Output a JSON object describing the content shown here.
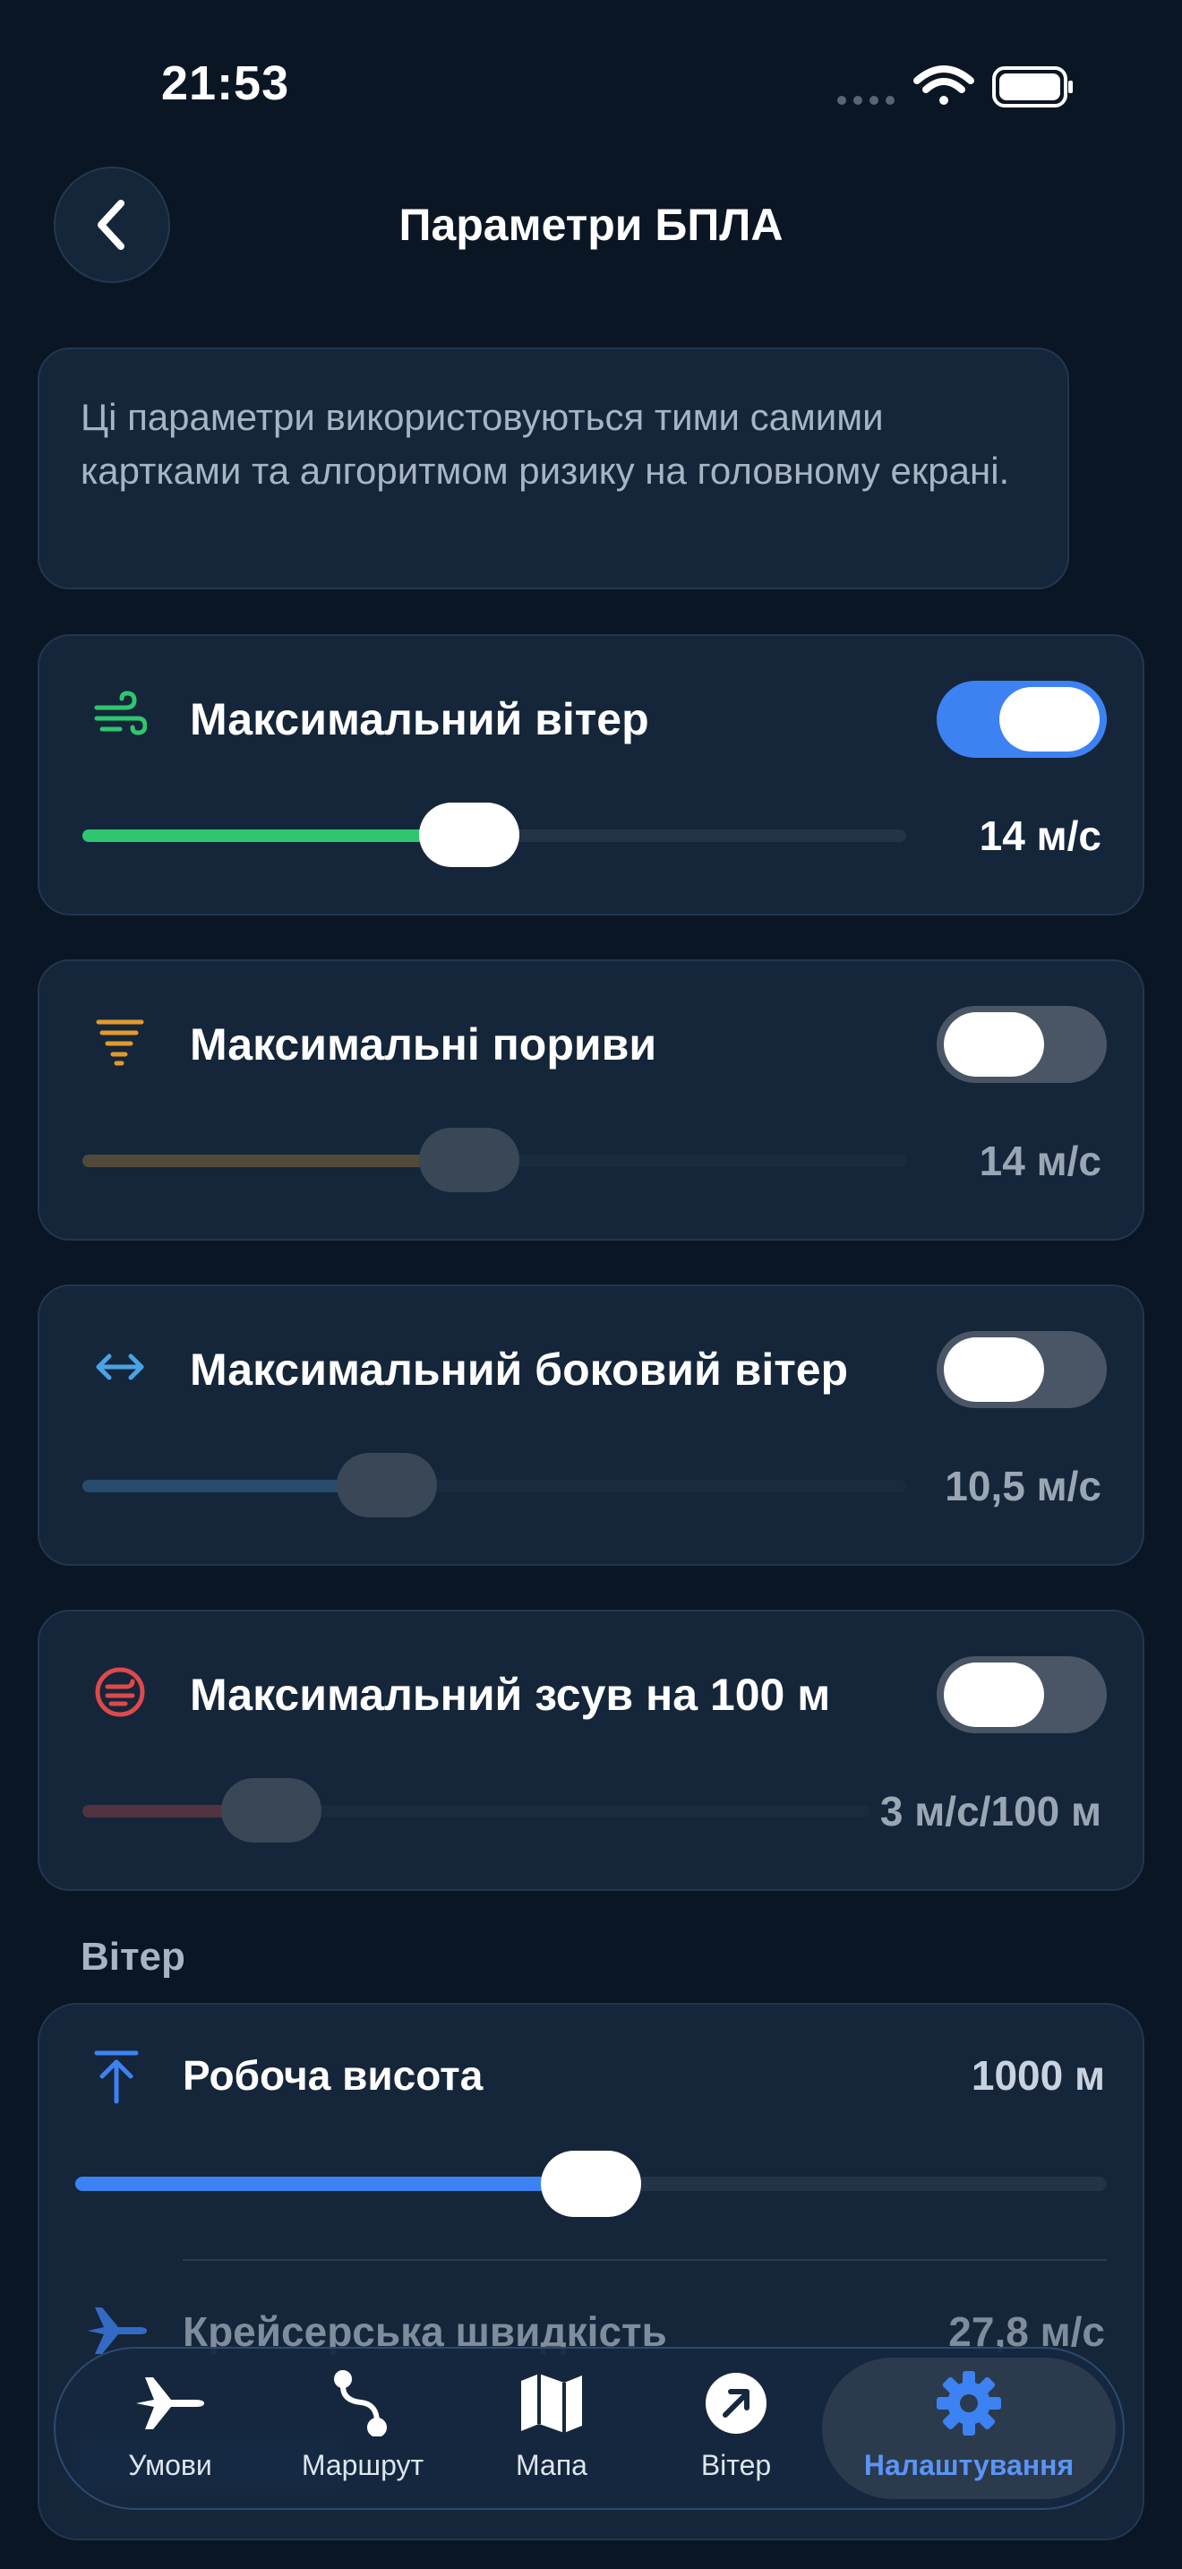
{
  "status_bar": {
    "time": "21:53"
  },
  "header": {
    "title": "Параметри БПЛА"
  },
  "info": {
    "text": "Ці параметри використовуються тими самими картками та алгоритмом ризику на головному екрані."
  },
  "cards": [
    {
      "title": "Максимальний вітер",
      "value": "14 м/с",
      "enabled": true,
      "level": 0.47,
      "accent": "#2fc66f",
      "icon": "wind-icon"
    },
    {
      "title": "Максимальні пориви",
      "value": "14 м/с",
      "enabled": false,
      "level": 0.47,
      "accent": "#e39a2c",
      "icon": "tornado-icon"
    },
    {
      "title": "Максимальний боковий вітер",
      "value": "10,5 м/с",
      "enabled": false,
      "level": 0.37,
      "accent": "#4aa3e6",
      "icon": "arrows-horizontal-icon"
    },
    {
      "title": "Максимальний зсув на 100 м",
      "value": "3 м/с/100 м",
      "enabled": false,
      "level": 0.24,
      "accent": "#e0494b",
      "icon": "shear-icon"
    }
  ],
  "wind_section": {
    "title": "Вітер",
    "altitude": {
      "label": "Робоча висота",
      "value": "1000 м",
      "level": 0.5
    },
    "cruise": {
      "label": "Крейсерська швидкість",
      "value": "27,8 м/с"
    }
  },
  "tabs": [
    {
      "label": "Умови",
      "icon": "airplane-icon",
      "active": false
    },
    {
      "label": "Маршрут",
      "icon": "route-icon",
      "active": false
    },
    {
      "label": "Мапа",
      "icon": "map-icon",
      "active": false
    },
    {
      "label": "Вітер",
      "icon": "compass-arrow-icon",
      "active": false
    },
    {
      "label": "Налаштування",
      "icon": "gear-icon",
      "active": true
    }
  ],
  "colors": {
    "background": "#0b1625",
    "card": "#15263a",
    "accent_blue": "#3d82f2"
  }
}
